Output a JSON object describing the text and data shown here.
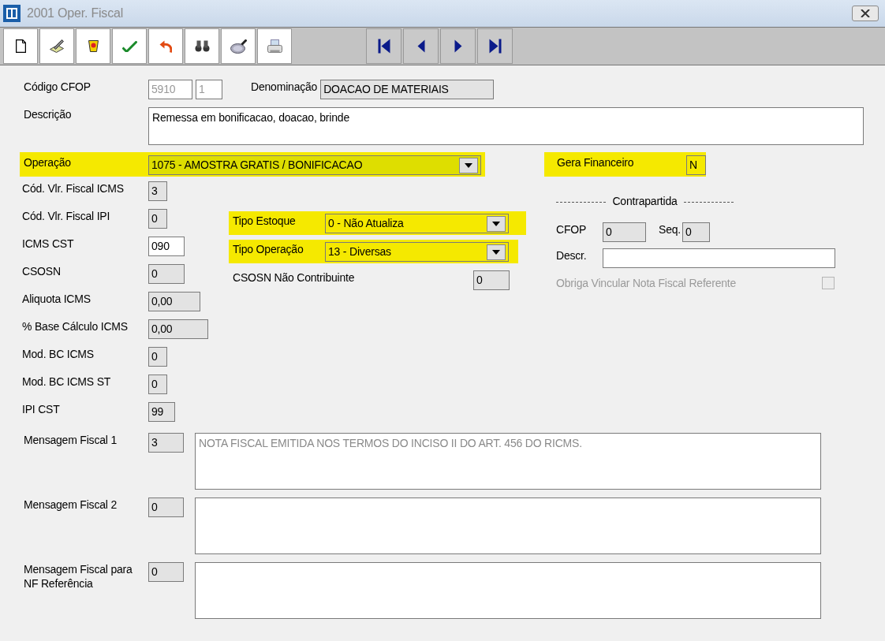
{
  "window": {
    "title": "2001 Oper. Fiscal"
  },
  "toolbar": {
    "buttons": [
      {
        "kind": "new"
      },
      {
        "kind": "edit"
      },
      {
        "kind": "delete"
      },
      {
        "kind": "confirm"
      },
      {
        "kind": "undo"
      },
      {
        "kind": "find"
      },
      {
        "kind": "zoom"
      },
      {
        "kind": "print"
      }
    ],
    "navigation": [
      {
        "kind": "first"
      },
      {
        "kind": "previous"
      },
      {
        "kind": "next"
      },
      {
        "kind": "last"
      }
    ]
  },
  "header": {
    "codigo": {
      "label": "Código CFOP",
      "value": "5910",
      "sequence": "1",
      "disabled": true
    },
    "denominacao": {
      "label": "Denominação",
      "value": "DOACAO DE MATERIAIS"
    },
    "descricao": {
      "label": "Descrição",
      "value": "Remessa em bonificacao, doacao, brinde"
    },
    "operacao": {
      "label": "Operação",
      "value": "1075 - AMOSTRA GRATIS / BONIFICACAO",
      "highlighted": true
    },
    "gera_financeiro": {
      "label": "Gera Financeiro",
      "value": "N",
      "highlighted": true
    }
  },
  "fiscal_fields": [
    {
      "label": "Cód. Vlr. Fiscal ICMS",
      "value": "3",
      "editable": false
    },
    {
      "label": "Cód. Vlr. Fiscal IPI",
      "value": "0",
      "editable": false
    },
    {
      "label": "ICMS CST",
      "value": "090",
      "editable": true
    },
    {
      "label": "CSOSN",
      "value": "0",
      "editable": false
    },
    {
      "label": "Aliquota ICMS",
      "value": "0,00",
      "editable": false
    },
    {
      "label": "% Base Cálculo ICMS",
      "value": "0,00",
      "editable": false
    },
    {
      "label": "Mod. BC ICMS",
      "value": "0",
      "editable": false
    },
    {
      "label": "Mod. BC ICMS ST",
      "value": "0",
      "editable": false
    },
    {
      "label": "IPI CST",
      "value": "99",
      "editable": false
    }
  ],
  "middle_fields": [
    {
      "kind": "select",
      "label": "Tipo Estoque",
      "value": "0 - Não Atualiza",
      "highlighted": true
    },
    {
      "kind": "select",
      "label": "Tipo Operação",
      "value": "13 - Diversas",
      "highlighted": true
    },
    {
      "kind": "text",
      "label": "CSOSN Não Contribuinte",
      "value": "0",
      "highlighted": false
    }
  ],
  "contrapartida": {
    "title": "Contrapartida",
    "cfop": {
      "label": "CFOP",
      "value": "0"
    },
    "seq": {
      "label": "Seq.",
      "value": "0"
    },
    "descr": {
      "label": "Descr."
    },
    "obriga": {
      "label": "Obriga Vincular Nota Fiscal Referente",
      "checked": false,
      "disabled": true
    }
  },
  "messages": [
    {
      "label": "Mensagem Fiscal 1",
      "code": "3",
      "text": "NOTA FISCAL EMITIDA NOS TERMOS DO INCISO II DO ART. 456 DO RICMS.",
      "disabled": true
    },
    {
      "label": "Mensagem Fiscal 2",
      "code": "0"
    },
    {
      "label": "Mensagem Fiscal para NF Referência",
      "code": "0"
    }
  ]
}
